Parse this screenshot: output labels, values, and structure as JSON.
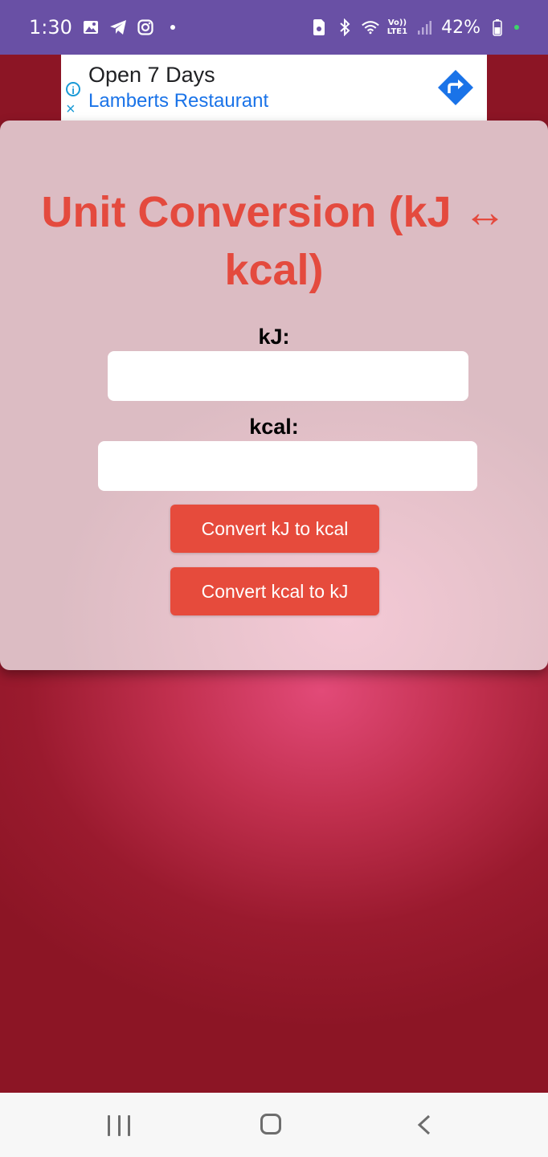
{
  "status_bar": {
    "time": "1:30",
    "battery": "42%",
    "network": "LTE1",
    "volte": "Vo))",
    "icons": [
      "gallery-icon",
      "telegram-icon",
      "instagram-icon",
      "notification-dot",
      "sim-icon",
      "bluetooth-icon",
      "wifi-icon",
      "signal-icon",
      "battery-icon"
    ]
  },
  "ad": {
    "title": "Open 7 Days",
    "subtitle": "Lamberts Restaurant",
    "info_glyph": "i",
    "close_glyph": "×"
  },
  "app": {
    "title": "Unit Conversion (kJ ↔ kcal)",
    "kj_label": "kJ:",
    "kj_value": "",
    "kcal_label": "kcal:",
    "kcal_value": "",
    "btn_kj_to_kcal": "Convert kJ to kcal",
    "btn_kcal_to_kj": "Convert kcal to kJ"
  },
  "colors": {
    "status_bar": "#6950a5",
    "accent": "#e64b3c",
    "title": "#e44a3e",
    "background": "#8c1525"
  },
  "nav_bar": {
    "items": [
      "recents-icon",
      "home-icon",
      "back-icon"
    ]
  }
}
